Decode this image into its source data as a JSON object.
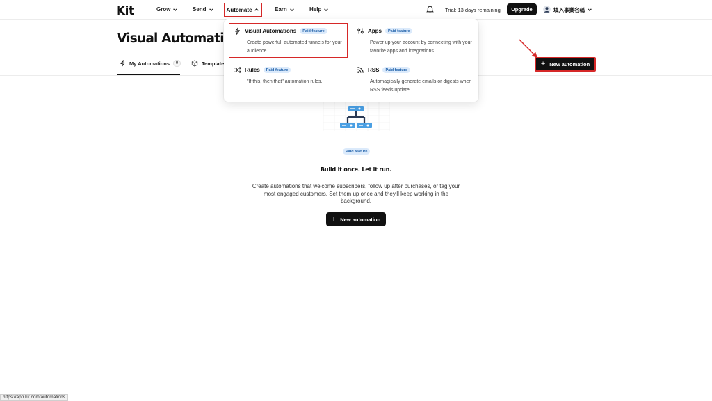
{
  "nav": {
    "logo": "Kit",
    "items": [
      {
        "label": "Grow"
      },
      {
        "label": "Send"
      },
      {
        "label": "Automate"
      },
      {
        "label": "Earn"
      },
      {
        "label": "Help"
      }
    ],
    "trial": "Trial: 13 days remaining",
    "upgrade": "Upgrade",
    "account_name": "填入事業名稱"
  },
  "page": {
    "title": "Visual Automations",
    "tabs": [
      {
        "label": "My Automations",
        "count": "0"
      },
      {
        "label": "Templates"
      }
    ],
    "new_automation": "New automation"
  },
  "dropdown": {
    "visual_automations": {
      "title": "Visual Automations",
      "badge": "Paid feature",
      "desc": "Create powerful, automated funnels for your audience."
    },
    "apps": {
      "title": "Apps",
      "badge": "Paid feature",
      "desc": "Power up your account by connecting with your favorite apps and integrations."
    },
    "rules": {
      "title": "Rules",
      "badge": "Paid feature",
      "desc": "\"If this, then that\" automation rules."
    },
    "rss": {
      "title": "RSS",
      "badge": "Paid feature",
      "desc": "Automagically generate emails or digests when RSS feeds update."
    }
  },
  "empty_state": {
    "badge": "Paid feature",
    "title": "Build it once. Let it run.",
    "desc": "Create automations that welcome subscribers, follow up after purchases, or tag your most engaged customers. Set them up once and they'll keep working in the background.",
    "button": "New automation"
  },
  "status_bar": {
    "url": "https://app.kit.com/automations"
  },
  "colors": {
    "accent_dark": "#111111",
    "annotation_red": "#d62828",
    "badge_bg": "#dbeafb",
    "badge_text": "#1d5fa8",
    "illustration_blue": "#4a9fe3"
  }
}
